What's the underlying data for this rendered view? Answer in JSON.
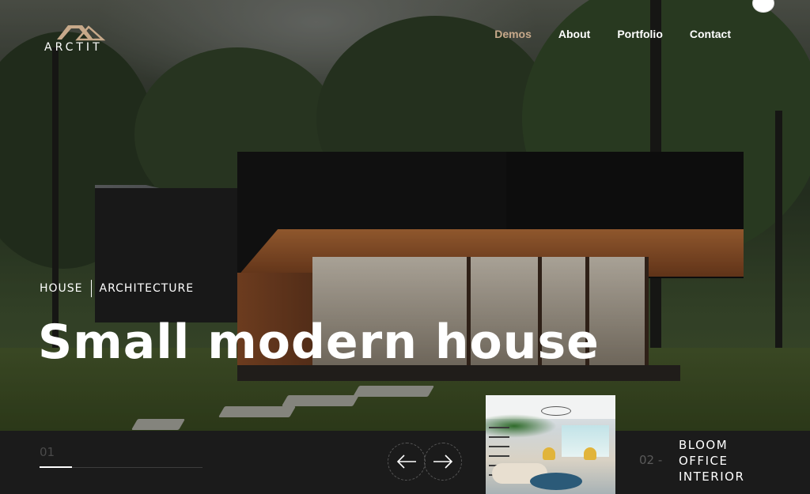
{
  "brand": {
    "logo_text": "ARCTIT",
    "logo_icon": "house-roof-logo-icon"
  },
  "nav": {
    "items": [
      {
        "label": "Demos",
        "active": true
      },
      {
        "label": "About",
        "active": false
      },
      {
        "label": "Portfolio",
        "active": false
      },
      {
        "label": "Contact",
        "active": false
      }
    ]
  },
  "theme_toggle": {
    "icon": "moon-icon"
  },
  "slide": {
    "category_1": "HOUSE",
    "category_2": "ARCHITECTURE",
    "title": "Small modern house"
  },
  "slider": {
    "current_number": "01",
    "progress": 0.2,
    "prev_icon": "arrow-left-icon",
    "next_icon": "arrow-right-icon",
    "next_slide": {
      "number": "02 -",
      "title_lines": [
        "BLOOM",
        "OFFICE",
        "INTERIOR"
      ]
    }
  },
  "colors": {
    "accent": "#c7a98a",
    "bar_bg": "#1b1b1b",
    "text": "#ffffff"
  }
}
